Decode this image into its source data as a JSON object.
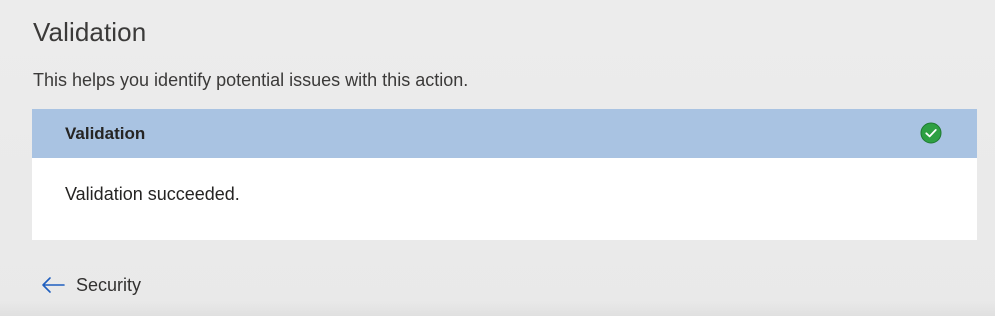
{
  "page": {
    "title": "Validation",
    "description": "This helps you identify potential issues with this action."
  },
  "validation_card": {
    "header_title": "Validation",
    "status_icon": "check-circle-icon",
    "status_color": "#2ea043",
    "header_color": "#a9c3e2",
    "message": "Validation succeeded."
  },
  "navigation": {
    "back_icon": "arrow-left-icon",
    "back_label": "Security",
    "accent_color": "#1f5fbf"
  }
}
